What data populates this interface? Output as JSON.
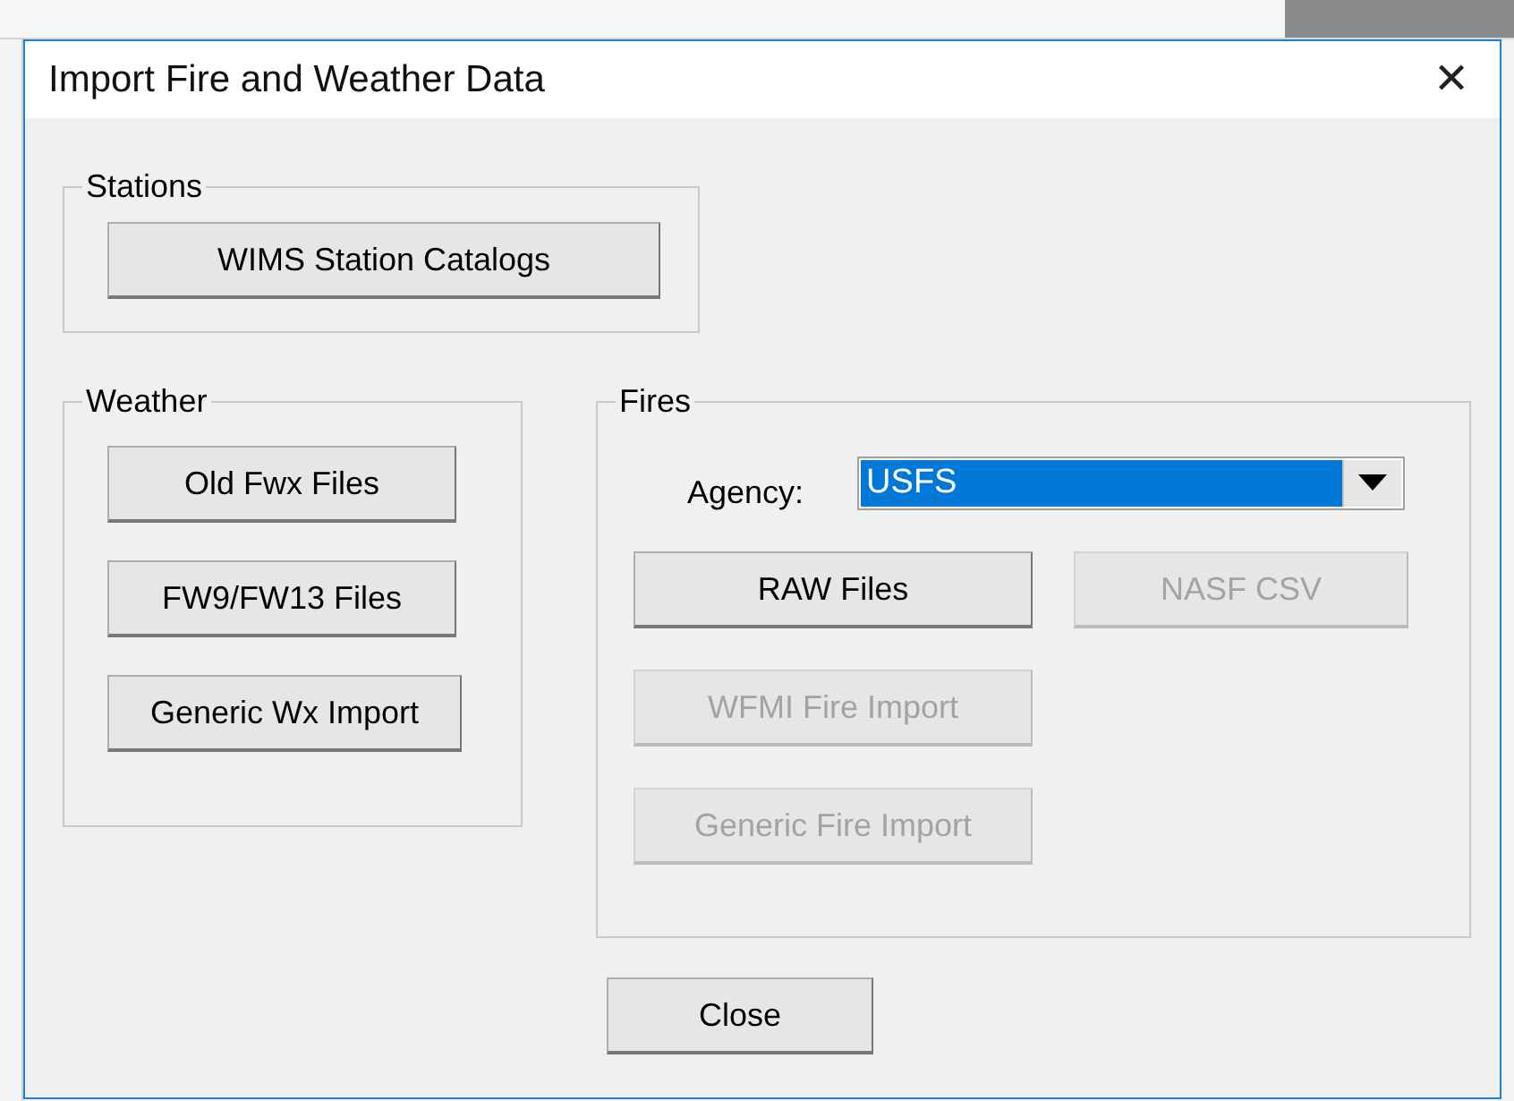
{
  "window": {
    "title": "Import Fire and Weather Data",
    "close_symbol": "✕"
  },
  "stations": {
    "label": "Stations",
    "buttons": [
      {
        "label": "WIMS Station Catalogs",
        "disabled": false
      }
    ]
  },
  "weather": {
    "label": "Weather",
    "buttons": [
      {
        "label": "Old Fwx Files",
        "disabled": false
      },
      {
        "label": "FW9/FW13 Files",
        "disabled": false
      },
      {
        "label": "Generic Wx Import",
        "disabled": false
      }
    ]
  },
  "fires": {
    "label": "Fires",
    "agency": {
      "label": "Agency:",
      "value": "USFS",
      "focused": true
    },
    "rows": [
      [
        {
          "label": "RAW Files",
          "disabled": false
        },
        {
          "label": "NASF CSV",
          "disabled": true
        }
      ],
      [
        {
          "label": "WFMI Fire Import",
          "disabled": true
        }
      ],
      [
        {
          "label": "Generic Fire Import",
          "disabled": true
        }
      ]
    ]
  },
  "close_button": {
    "label": "Close",
    "disabled": false
  }
}
